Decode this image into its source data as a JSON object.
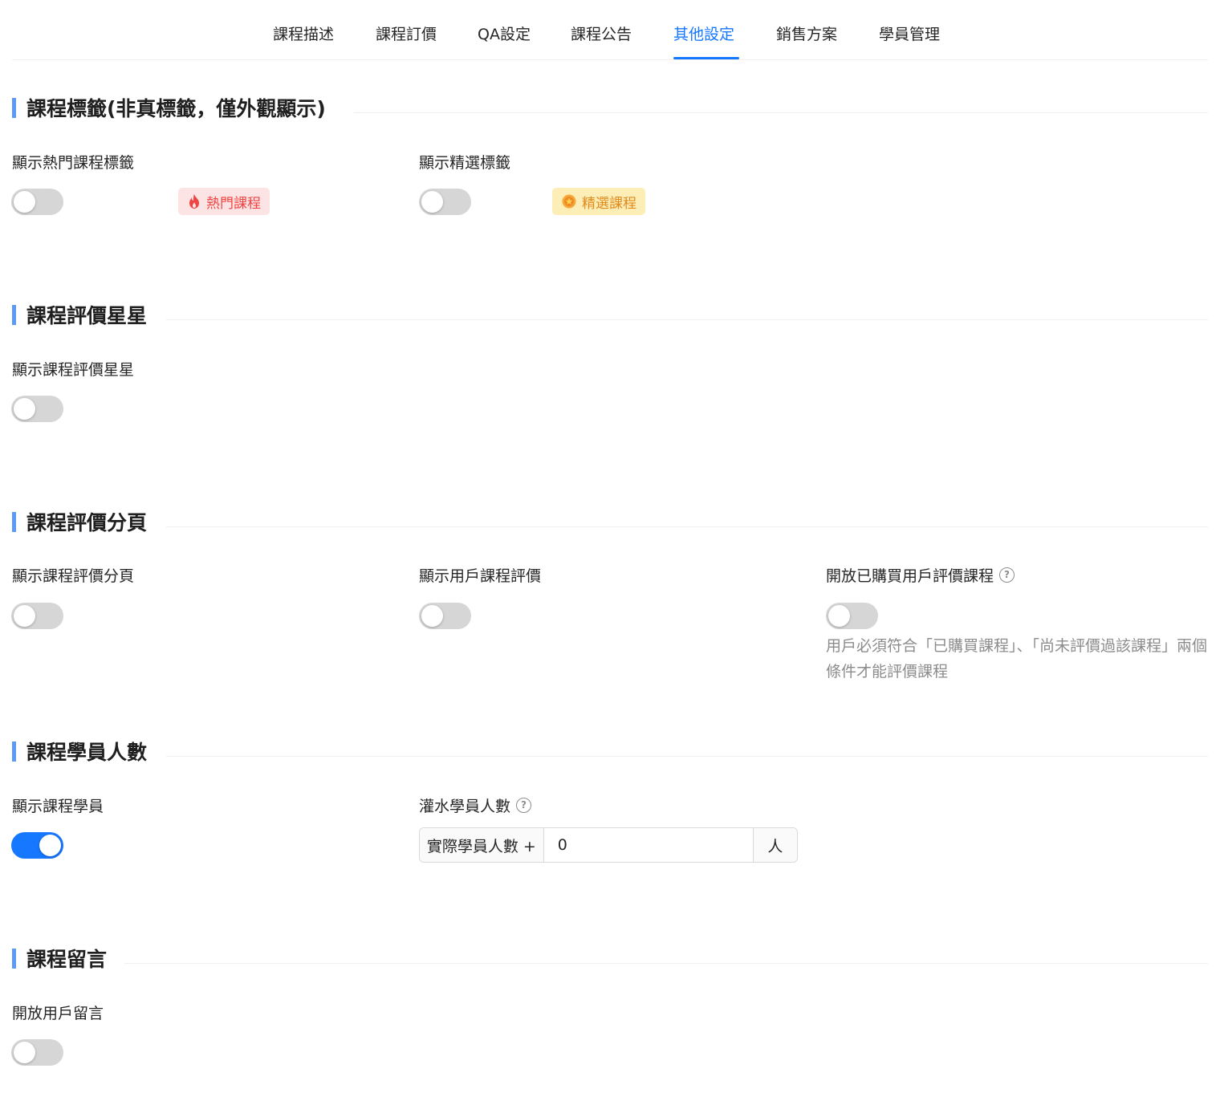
{
  "tabs": [
    {
      "label": "課程描述",
      "active": false
    },
    {
      "label": "課程訂價",
      "active": false
    },
    {
      "label": "QA設定",
      "active": false
    },
    {
      "label": "課程公告",
      "active": false
    },
    {
      "label": "其他設定",
      "active": true
    },
    {
      "label": "銷售方案",
      "active": false
    },
    {
      "label": "學員管理",
      "active": false
    }
  ],
  "sections": {
    "tags": {
      "title": "課程標籤(非真標籤，僅外觀顯示)",
      "hot_label": "顯示熱門課程標籤",
      "hot_on": false,
      "hot_tag": "熱門課程",
      "featured_label": "顯示精選標籤",
      "featured_on": false,
      "featured_tag": "精選課程"
    },
    "stars": {
      "title": "課程評價星星",
      "show_label": "顯示課程評價星星",
      "show_on": false
    },
    "pagination": {
      "title": "課程評價分頁",
      "show_label": "顯示課程評價分頁",
      "show_on": false,
      "user_label": "顯示用戶課程評價",
      "user_on": false,
      "open_label": "開放已購買用戶評價課程",
      "open_on": false,
      "hint": "用戶必須符合「已購買課程」、「尚未評價過該課程」兩個條件才能評價課程"
    },
    "students": {
      "title": "課程學員人數",
      "show_label": "顯示課程學員",
      "show_on": true,
      "padding_label": "灌水學員人數",
      "addon_before": "實際學員人數 +",
      "value": "0",
      "addon_after": "人"
    },
    "comments": {
      "title": "課程留言",
      "open_label": "開放用戶留言",
      "open_on": false
    }
  },
  "colors": {
    "primary": "#1677ff",
    "section_bar": "#5b9bf5",
    "hot_tag_bg": "#fde4e4",
    "hot_tag_text": "#ef4444",
    "featured_tag_bg": "#fdeeb8",
    "featured_tag_text": "#e08a1a"
  },
  "icons": {
    "hot": "fire-icon",
    "featured": "star-badge-icon",
    "help": "question-circle-icon"
  }
}
